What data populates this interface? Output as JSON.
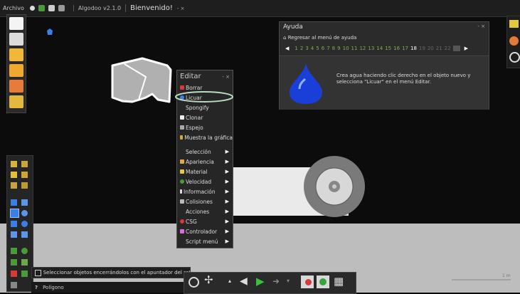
{
  "topbar": {
    "menu_archivo": "Archivo",
    "tab_version": "Algodoo v2.1.0",
    "tab_welcome": "Bienvenido!",
    "tab_controls": "- ×"
  },
  "help_panel": {
    "title": "Ayuda",
    "controls": "- ×",
    "back_link": "Regresar al menú de ayuda",
    "pages": [
      "1",
      "2",
      "3",
      "4",
      "5",
      "6",
      "7",
      "8",
      "9",
      "10",
      "11",
      "12",
      "13",
      "14",
      "15",
      "16",
      "17",
      "18",
      "19",
      "20",
      "21",
      "22"
    ],
    "current_page": "18",
    "body_text": "Crea agua haciendo clic derecho en el objeto nuevo y selecciona \"Licuar\" en el menú Editar."
  },
  "edit_menu": {
    "title": "Editar",
    "controls": "- ×",
    "items": [
      {
        "label": "Borrar"
      },
      {
        "label": "Licuar"
      },
      {
        "label": "Spongify"
      },
      {
        "label": "Clonar"
      },
      {
        "label": "Espejo"
      },
      {
        "label": "Muestra la gráfica"
      }
    ],
    "submenus": [
      {
        "label": "Selección"
      },
      {
        "label": "Apariencia"
      },
      {
        "label": "Material"
      },
      {
        "label": "Velocidad"
      },
      {
        "label": "Información"
      },
      {
        "label": "Colisiones"
      },
      {
        "label": "Acciones"
      },
      {
        "label": "CSG"
      },
      {
        "label": "Controlador"
      },
      {
        "label": "Script menú"
      }
    ]
  },
  "status": {
    "hint": "Seleccionar objetos encerrándolos con el apuntador del ratón",
    "tool_name": "Polígono"
  },
  "scale": {
    "label": "1 m"
  },
  "colors": {
    "accent_green": "#7ab34a",
    "highlight_ring": "#b8dcc2",
    "water_blue": "#1a3fd8"
  }
}
